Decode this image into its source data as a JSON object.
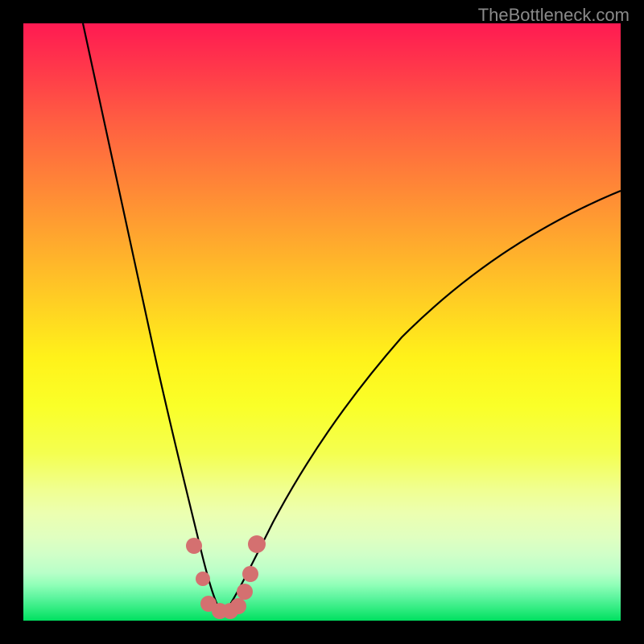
{
  "watermark": "TheBottleneck.com",
  "chart_data": {
    "type": "line",
    "title": "",
    "xlabel": "",
    "ylabel": "",
    "xlim": [
      0,
      100
    ],
    "ylim": [
      0,
      100
    ],
    "note": "Axes unlabeled; values estimated from pixel positions on a 0–100 normalized grid. Background gradient encodes severity (red high → green low). Black curves form a V-shaped bottleneck curve with minimum near x≈33. Salmon dots cluster at the trough.",
    "series": [
      {
        "name": "left-branch",
        "x": [
          10,
          14,
          18,
          22,
          26,
          28,
          30,
          32,
          33
        ],
        "y": [
          100,
          82,
          64,
          46,
          30,
          20,
          12,
          5,
          1
        ]
      },
      {
        "name": "right-branch",
        "x": [
          33,
          36,
          40,
          46,
          54,
          64,
          76,
          88,
          100
        ],
        "y": [
          1,
          6,
          14,
          24,
          36,
          48,
          58,
          66,
          72
        ]
      }
    ],
    "highlight_points": {
      "name": "bottleneck-cluster",
      "color": "#d47070",
      "points": [
        {
          "x": 28.5,
          "y": 12.5
        },
        {
          "x": 30.0,
          "y": 7.0
        },
        {
          "x": 31.0,
          "y": 2.8
        },
        {
          "x": 32.8,
          "y": 1.6
        },
        {
          "x": 34.6,
          "y": 1.6
        },
        {
          "x": 36.0,
          "y": 2.4
        },
        {
          "x": 37.0,
          "y": 4.8
        },
        {
          "x": 38.0,
          "y": 7.8
        },
        {
          "x": 39.0,
          "y": 12.8
        }
      ]
    }
  }
}
